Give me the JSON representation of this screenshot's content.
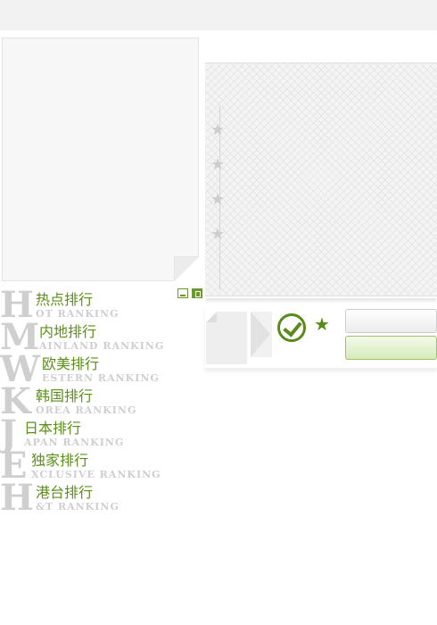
{
  "rankings": [
    {
      "initial": "H",
      "cn": "热点排行",
      "en": "OT RANKING"
    },
    {
      "initial": "M",
      "cn": "内地排行",
      "en": "AINLAND RANKING"
    },
    {
      "initial": "W",
      "cn": "欧美排行",
      "en": "ESTERN RANKING"
    },
    {
      "initial": "K",
      "cn": "韩国排行",
      "en": "OREA RANKING"
    },
    {
      "initial": "J",
      "cn": "日本排行",
      "en": "APAN RANKING"
    },
    {
      "initial": "E",
      "cn": "独家排行",
      "en": "XCLUSIVE RANKING"
    },
    {
      "initial": "H",
      "cn": "港台排行",
      "en": "&T RANKING"
    }
  ],
  "panel": {
    "stars": [
      "★",
      "★",
      "★",
      "★"
    ]
  },
  "controls": {
    "fav_glyph": "★",
    "button_one_label": "",
    "button_two_label": ""
  },
  "colors": {
    "accent": "#5c8f1a",
    "muted": "#cfcfcf"
  }
}
